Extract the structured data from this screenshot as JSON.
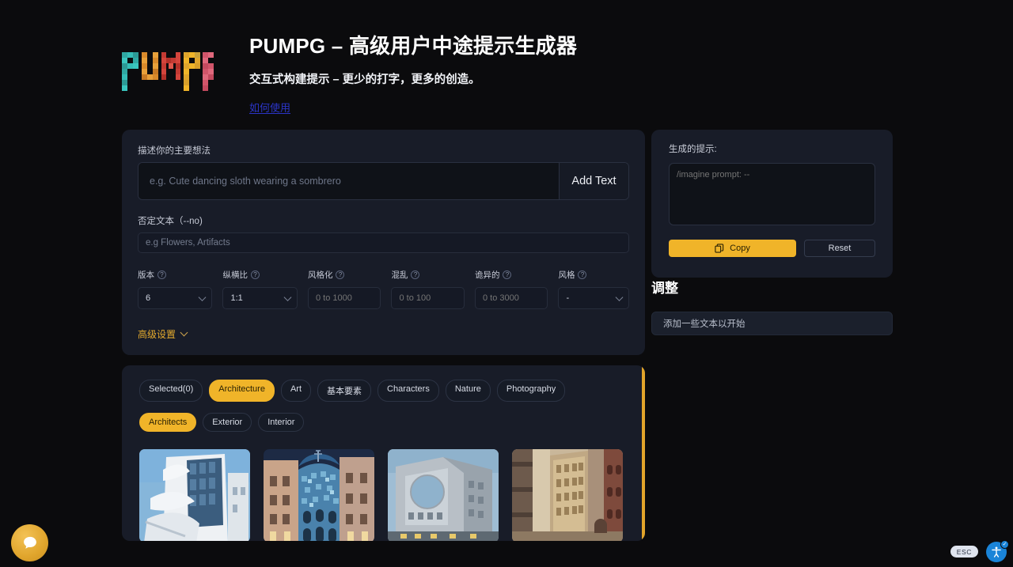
{
  "header": {
    "logo_alt": "PUMPG",
    "title": "PUMPG – 高级用户中途提示生成器",
    "tagline": "交互式构建提示 – 更少的打字，更多的创造。",
    "howto_link": "如何使用"
  },
  "form": {
    "main_idea_label": "描述你的主要想法",
    "main_idea_placeholder": "e.g. Cute dancing sloth wearing a sombrero",
    "main_idea_value": "",
    "add_text_button": "Add Text",
    "negative_label": "否定文本（--no)",
    "negative_placeholder": "e.g Flowers, Artifacts",
    "negative_value": "",
    "help_glyph": "?",
    "advanced_label": "高级设置",
    "params": [
      {
        "label": "版本",
        "type": "select",
        "value": "6",
        "placeholder": ""
      },
      {
        "label": "纵横比",
        "type": "select",
        "value": "1:1",
        "placeholder": ""
      },
      {
        "label": "风格化",
        "type": "number",
        "value": "",
        "placeholder": "0 to 1000"
      },
      {
        "label": "混乱",
        "type": "number",
        "value": "",
        "placeholder": "0 to 100"
      },
      {
        "label": "诡异的",
        "type": "number",
        "value": "",
        "placeholder": "0 to 3000"
      },
      {
        "label": "风格",
        "type": "select",
        "value": "-",
        "placeholder": ""
      }
    ]
  },
  "output": {
    "label": "生成的提示:",
    "prompt_placeholder": "/imagine prompt: --",
    "prompt_value": "",
    "copy_button": "Copy",
    "reset_button": "Reset"
  },
  "adjust": {
    "title": "调整",
    "hint": "添加一些文本以开始"
  },
  "gallery": {
    "tabs": [
      {
        "label": "Selected(0)",
        "active": false
      },
      {
        "label": "Architecture",
        "active": true
      },
      {
        "label": "Art",
        "active": false
      },
      {
        "label": "基本要素",
        "active": false
      },
      {
        "label": "Characters",
        "active": false
      },
      {
        "label": "Nature",
        "active": false
      },
      {
        "label": "Photography",
        "active": false
      }
    ],
    "subtabs": [
      {
        "label": "Architects",
        "active": true
      },
      {
        "label": "Exterior",
        "active": false
      },
      {
        "label": "Interior",
        "active": false
      }
    ],
    "thumbnails": [
      {
        "name": "curved-white-modern-building"
      },
      {
        "name": "casa-batllo-mosaic-facade"
      },
      {
        "name": "concrete-circular-void-building"
      },
      {
        "name": "historic-stone-highrise-painting"
      }
    ]
  },
  "widgets": {
    "chat_label": "chat-bubble",
    "esc_badge": "ESC",
    "accessibility_label": "accessibility"
  },
  "colors": {
    "accent_gold": "#f0b429",
    "panel_bg": "#181c28",
    "page_bg": "#0b0b0d",
    "link_blue": "#2b35c8"
  }
}
